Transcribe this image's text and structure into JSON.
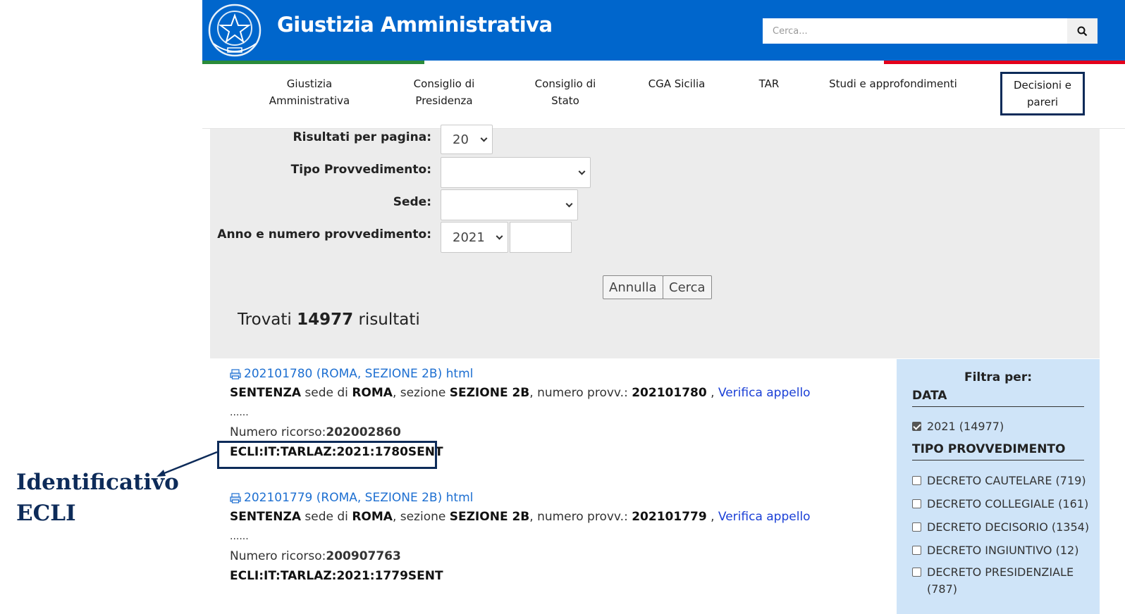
{
  "header": {
    "site_title": "Giustizia Amministrativa",
    "search_placeholder": "Cerca..."
  },
  "nav": {
    "items": [
      {
        "line1": "Giustizia",
        "line2": "Amministrativa"
      },
      {
        "line1": "Consiglio di",
        "line2": "Presidenza"
      },
      {
        "line1": "Consiglio di",
        "line2": "Stato"
      },
      {
        "line1": "CGA Sicilia",
        "line2": ""
      },
      {
        "line1": "TAR",
        "line2": ""
      },
      {
        "line1": "Studi e approfondimenti",
        "line2": ""
      },
      {
        "line1": "Decisioni e",
        "line2": "pareri"
      }
    ]
  },
  "form": {
    "results_per_page_label": "Risultati per pagina:",
    "results_per_page_value": "20",
    "tipo_label": "Tipo Provvedimento:",
    "tipo_value": "",
    "sede_label": "Sede:",
    "sede_value": "",
    "anno_label": "Anno e numero provvedimento:",
    "anno_value": "2021",
    "numero_value": "",
    "annulla_label": "Annulla",
    "cerca_label": "Cerca"
  },
  "summary": {
    "prefix": "Trovati",
    "count": "14977",
    "suffix": "risultati"
  },
  "results": [
    {
      "link": "202101780 (ROMA, SEZIONE 2B) html",
      "tipo": "SENTENZA",
      "sede_text": "sede di",
      "sede": "ROMA",
      "sezione_text": ", sezione",
      "sezione": "SEZIONE 2B",
      "numero_text": ", numero provv.:",
      "numero": "202101780",
      "appello": "Verifica appello",
      "dots": "......",
      "ricorso_label": "Numero ricorso:",
      "ricorso": "202002860",
      "ecli": "ECLI:IT:TARLAZ:2021:1780SENT"
    },
    {
      "link": "202101779 (ROMA, SEZIONE 2B) html",
      "tipo": "SENTENZA",
      "sede_text": "sede di",
      "sede": "ROMA",
      "sezione_text": ", sezione",
      "sezione": "SEZIONE 2B",
      "numero_text": ", numero provv.:",
      "numero": "202101779",
      "appello": "Verifica appello",
      "dots": "......",
      "ricorso_label": "Numero ricorso:",
      "ricorso": "200907763",
      "ecli": "ECLI:IT:TARLAZ:2021:1779SENT"
    }
  ],
  "sidebar": {
    "title": "Filtra per:",
    "data_heading": "DATA",
    "data_items": [
      {
        "label": "2021 (14977)",
        "checked": true
      }
    ],
    "tipo_heading": "TIPO PROVVEDIMENTO",
    "tipo_items": [
      {
        "label": "DECRETO CAUTELARE (719)",
        "checked": false
      },
      {
        "label": "DECRETO COLLEGIALE (161)",
        "checked": false
      },
      {
        "label": "DECRETO DECISORIO (1354)",
        "checked": false
      },
      {
        "label": "DECRETO INGIUNTIVO (12)",
        "checked": false
      },
      {
        "label": "DECRETO PRESIDENZIALE",
        "label2": "(787)",
        "checked": false
      }
    ]
  },
  "annotation": {
    "line1": "Identificativo",
    "line2": "ECLI",
    "color": "#0d2b59"
  },
  "colors": {
    "brand_blue": "#0066cc",
    "link_blue": "#1d6fd1",
    "flag_green": "#2a8b3a",
    "flag_red": "#e3001b",
    "sidebar_bg": "#cfe4f8"
  }
}
